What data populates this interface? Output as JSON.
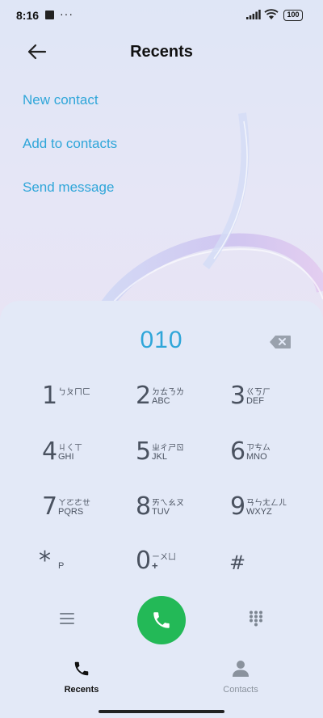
{
  "status_bar": {
    "time": "8:16",
    "dots": "···",
    "battery": "100"
  },
  "header": {
    "title": "Recents",
    "back_icon": "arrow-left-icon"
  },
  "actions": [
    {
      "label": "New contact"
    },
    {
      "label": "Add to contacts"
    },
    {
      "label": "Send message"
    }
  ],
  "dialer": {
    "number": "010",
    "keys": [
      {
        "digit": "1",
        "zh": "ㄅㄆㄇㄈ",
        "en": ""
      },
      {
        "digit": "2",
        "zh": "ㄉㄊㄋㄌ",
        "en": "ABC"
      },
      {
        "digit": "3",
        "zh": "ㄍㄎㄏ",
        "en": "DEF"
      },
      {
        "digit": "4",
        "zh": "ㄐㄑㄒ",
        "en": "GHI"
      },
      {
        "digit": "5",
        "zh": "ㄓㄔㄕㄖ",
        "en": "JKL"
      },
      {
        "digit": "6",
        "zh": "ㄗㄘㄙ",
        "en": "MNO"
      },
      {
        "digit": "7",
        "zh": "ㄚㄛㄜㄝ",
        "en": "PQRS"
      },
      {
        "digit": "8",
        "zh": "ㄞㄟㄠㄡ",
        "en": "TUV"
      },
      {
        "digit": "9",
        "zh": "ㄢㄣㄤㄥㄦ",
        "en": "WXYZ"
      },
      {
        "digit": "*",
        "zh": "",
        "en": "P"
      },
      {
        "digit": "0",
        "zh": "ㄧㄨㄩ",
        "en": "+"
      },
      {
        "digit": "#",
        "zh": "",
        "en": ""
      }
    ]
  },
  "bottom_nav": {
    "recents": "Recents",
    "contacts": "Contacts"
  },
  "colors": {
    "accent": "#2fa6d9",
    "call": "#23b957",
    "key_text": "#4a5260"
  }
}
